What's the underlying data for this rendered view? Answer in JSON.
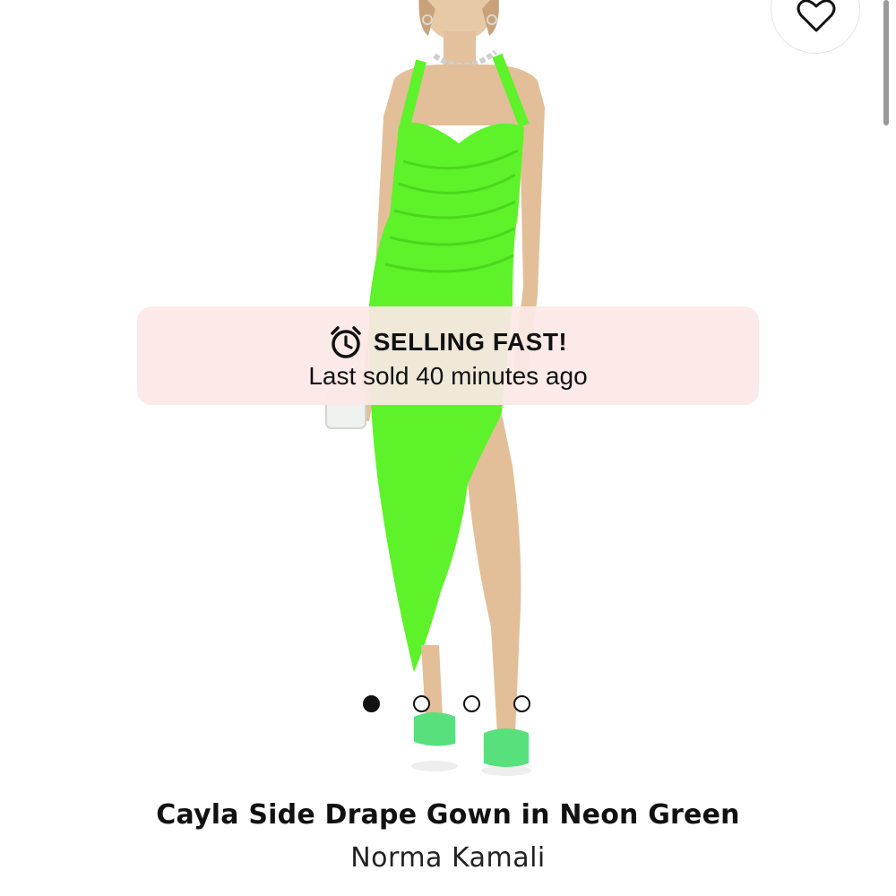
{
  "product": {
    "title": "Cayla Side Drape Gown in Neon Green",
    "brand": "Norma Kamali",
    "image_icon": "model-in-neon-green-gown-image"
  },
  "wishlist": {
    "icon": "heart-icon"
  },
  "urgency": {
    "icon": "alarm-clock-icon",
    "title": "SELLING FAST!",
    "subtitle": "Last sold 40 minutes ago"
  },
  "carousel": {
    "current_index": 1,
    "total": 4
  },
  "colors": {
    "dress": "#5ef22a",
    "banner_bg": "#fce8e6",
    "text": "#111111"
  }
}
